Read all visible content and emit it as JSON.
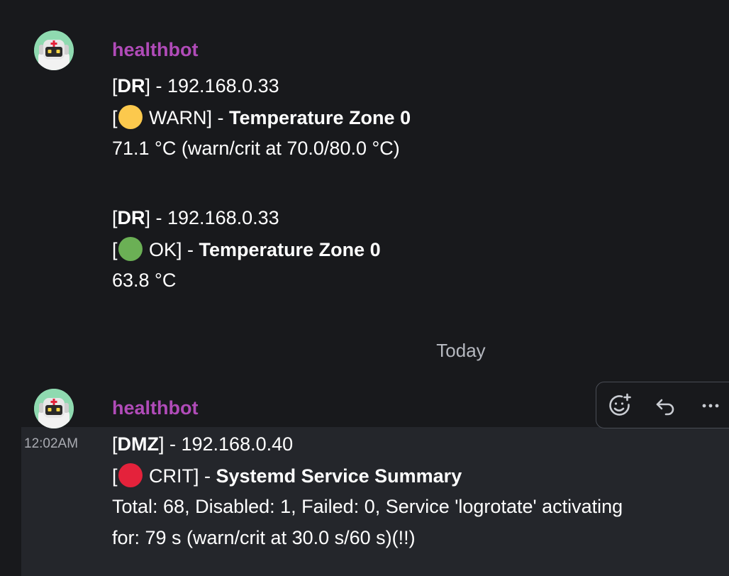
{
  "colors": {
    "background": "#18191c",
    "username": "#b04bb8",
    "warn_dot": "#fcc94d",
    "ok_dot": "#6bb055",
    "crit_dot": "#e4223b",
    "highlight_bg": "#24262b"
  },
  "messages": [
    {
      "sender": "healthbot",
      "avatar_icon": "robot-avatar-icon",
      "entries": [
        {
          "host_open": "[",
          "host_tag": "DR",
          "host_close": "] - 192.168.0.33",
          "status_open": "[",
          "status_icon": "yellow-circle-icon",
          "status_text": " WARN] - ",
          "check_name": "Temperature Zone 0",
          "detail": "71.1 °C (warn/crit at 70.0/80.0 °C)"
        },
        {
          "host_open": "[",
          "host_tag": "DR",
          "host_close": "] - 192.168.0.33",
          "status_open": "[",
          "status_icon": "green-circle-icon",
          "status_text": " OK] - ",
          "check_name": "Temperature Zone 0",
          "detail": "63.8 °C"
        }
      ]
    },
    {
      "sender": "healthbot",
      "avatar_icon": "robot-avatar-icon",
      "timestamp": "12:02AM",
      "entries": [
        {
          "host_open": "[",
          "host_tag": "DMZ",
          "host_close": "] - 192.168.0.40",
          "status_open": "[",
          "status_icon": "red-circle-icon",
          "status_text": " CRIT] - ",
          "check_name": "Systemd Service Summary",
          "detail_line1": "Total: 68, Disabled: 1, Failed: 0, Service 'logrotate' activating",
          "detail_line2": "for: 79 s (warn/crit at 30.0 s/60 s)(!!)"
        }
      ]
    }
  ],
  "day_divider": "Today",
  "message_actions": [
    {
      "icon": "add-reaction-icon"
    },
    {
      "icon": "reply-icon"
    },
    {
      "icon": "more-options-icon"
    }
  ]
}
